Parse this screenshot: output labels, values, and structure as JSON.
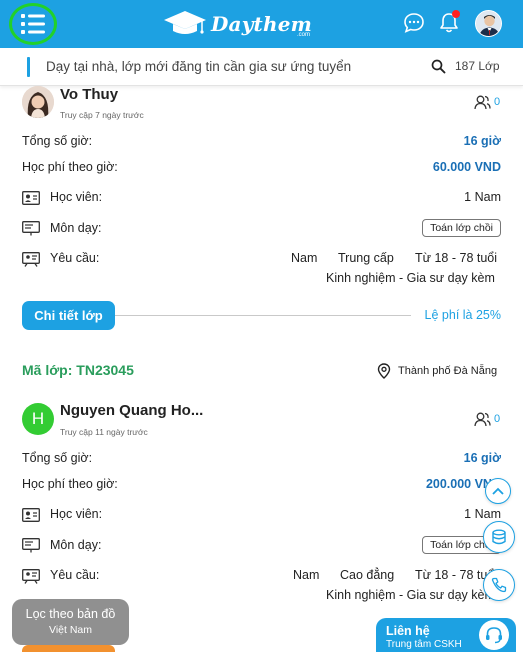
{
  "header": {
    "logo_text": "Daythem",
    "logo_sub": ".com"
  },
  "search": {
    "placeholder": "Dạy tại nhà, lớp mới đăng tin cần gia sư ứng tuyển",
    "count": "187 Lớp"
  },
  "cards": [
    {
      "name": "Vo Thuy",
      "access": "Truy cập 7 ngày trước",
      "applicants": "0",
      "hours_label": "Tổng số giờ:",
      "hours_value": "16 giờ",
      "fee_label": "Học phí theo giờ:",
      "fee_value": "60.000 VND",
      "students_label": "Học viên:",
      "students_value": "1 Nam",
      "subject_label": "Môn dạy:",
      "subject_value": "Toán lớp chồi",
      "req_label": "Yêu cầu:",
      "req_gender": "Nam",
      "req_level": "Trung cấp",
      "req_age": "Từ 18 - 78 tuổi",
      "req_exp": "Kinh nghiệm - Gia sư dạy kèm",
      "detail_button": "Chi tiết lớp",
      "fee_note": "Lệ phí là 25%"
    },
    {
      "class_code": "Mã lớp: TN23045",
      "location": "Thành phố Đà Nẵng",
      "initial": "H",
      "name": "Nguyen Quang Ho...",
      "access": "Truy cập 11 ngày trước",
      "applicants": "0",
      "hours_label": "Tổng số giờ:",
      "hours_value": "16 giờ",
      "fee_label": "Học phí theo giờ:",
      "fee_value": "200.000 VND",
      "students_label": "Học viên:",
      "students_value": "1 Nam",
      "subject_label": "Môn dạy:",
      "subject_value": "Toán lớp chồi",
      "req_label": "Yêu cầu:",
      "req_gender": "Nam",
      "req_level": "Cao đẳng",
      "req_age": "Từ 18 - 78 tuổi",
      "req_exp": "Kinh nghiệm - Gia sư dạy kèm"
    }
  ],
  "map_filter": {
    "line1": "Lọc theo bản đồ",
    "line2": "Việt Nam"
  },
  "contact": {
    "title": "Liên hệ",
    "subtitle": "Trung tâm CSKH"
  },
  "colors": {
    "primary": "#1da1e2",
    "class_code": "#2a9d5c",
    "price": "#1a6fb5",
    "highlight": "#22d12a"
  }
}
